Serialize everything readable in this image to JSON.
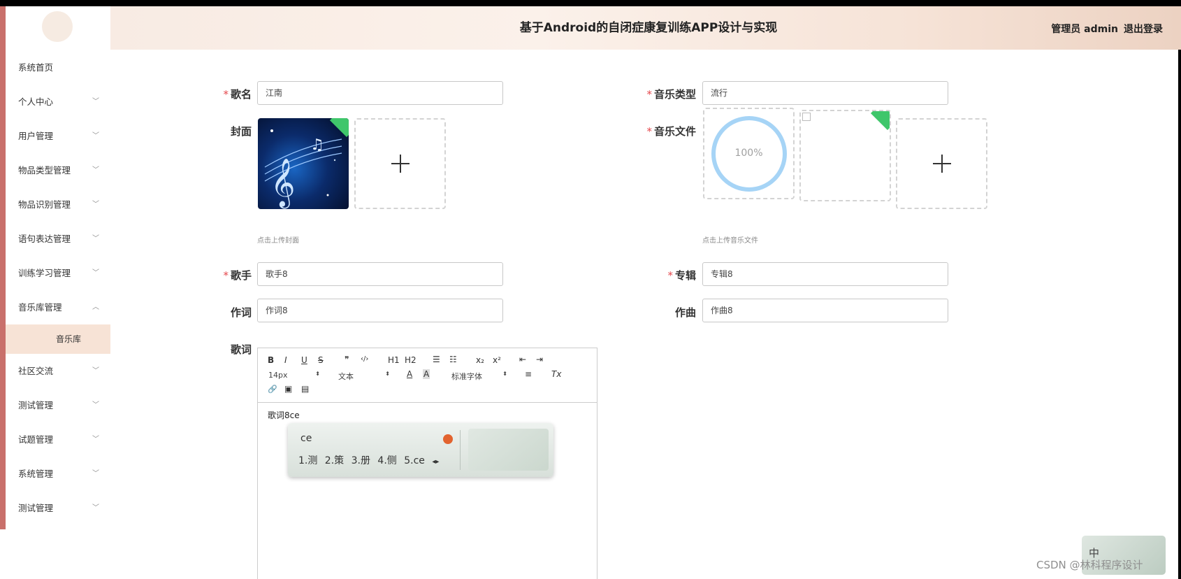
{
  "header": {
    "title": "基于Android的自闭症康复训练APP设计与实现",
    "user_label": "管理员 admin",
    "logout_label": "退出登录"
  },
  "sidebar": {
    "items": [
      {
        "label": "系统首页",
        "has_chevron": false
      },
      {
        "label": "个人中心",
        "has_chevron": true
      },
      {
        "label": "用户管理",
        "has_chevron": true
      },
      {
        "label": "物品类型管理",
        "has_chevron": true
      },
      {
        "label": "物品识别管理",
        "has_chevron": true
      },
      {
        "label": "语句表达管理",
        "has_chevron": true
      },
      {
        "label": "训练学习管理",
        "has_chevron": true
      },
      {
        "label": "音乐库管理",
        "has_chevron": true,
        "expanded": true
      },
      {
        "label": "社区交流",
        "has_chevron": true
      },
      {
        "label": "测试管理",
        "has_chevron": true
      },
      {
        "label": "试题管理",
        "has_chevron": true
      },
      {
        "label": "系统管理",
        "has_chevron": true
      },
      {
        "label": "测试管理",
        "has_chevron": true
      }
    ],
    "active_submenu": "音乐库"
  },
  "form": {
    "song_name": {
      "label": "歌名",
      "required": true,
      "value": "江南"
    },
    "music_type": {
      "label": "音乐类型",
      "required": true,
      "value": "流行"
    },
    "cover": {
      "label": "封面",
      "required": false,
      "hint": "点击上传封面"
    },
    "music_file": {
      "label": "音乐文件",
      "required": true,
      "hint": "点击上传音乐文件",
      "progress_text": "100%"
    },
    "singer": {
      "label": "歌手",
      "required": true,
      "value": "歌手8"
    },
    "album": {
      "label": "专辑",
      "required": true,
      "value": "专辑8"
    },
    "lyricist": {
      "label": "作词",
      "required": false,
      "value": "作词8"
    },
    "composer": {
      "label": "作曲",
      "required": false,
      "value": "作曲8"
    },
    "lyrics": {
      "label": "歌词",
      "value": "歌词8ce"
    }
  },
  "editor": {
    "toolbar": {
      "bold": "B",
      "italic": "I",
      "underline": "U",
      "strike": "S",
      "quote": "❞",
      "code": "‹/›",
      "h1": "H1",
      "h2": "H2",
      "ordered_list": "☰",
      "bullet_list": "☷",
      "subscript": "x₂",
      "superscript": "x²",
      "outdent": "⇤",
      "indent": "⇥",
      "font_size": "14px",
      "header_select": "文本",
      "font_family": "标准字体",
      "color": "A",
      "background": "A",
      "align": "≡",
      "clear_format": "Tx",
      "link": "🔗",
      "image": "▣",
      "video": "▤"
    }
  },
  "ime": {
    "input_text": "ce",
    "candidates": "1.测 2.策 3.册 4.侧 5.ce",
    "mini_char": "中"
  },
  "watermark": "CSDN @林科程序设计"
}
